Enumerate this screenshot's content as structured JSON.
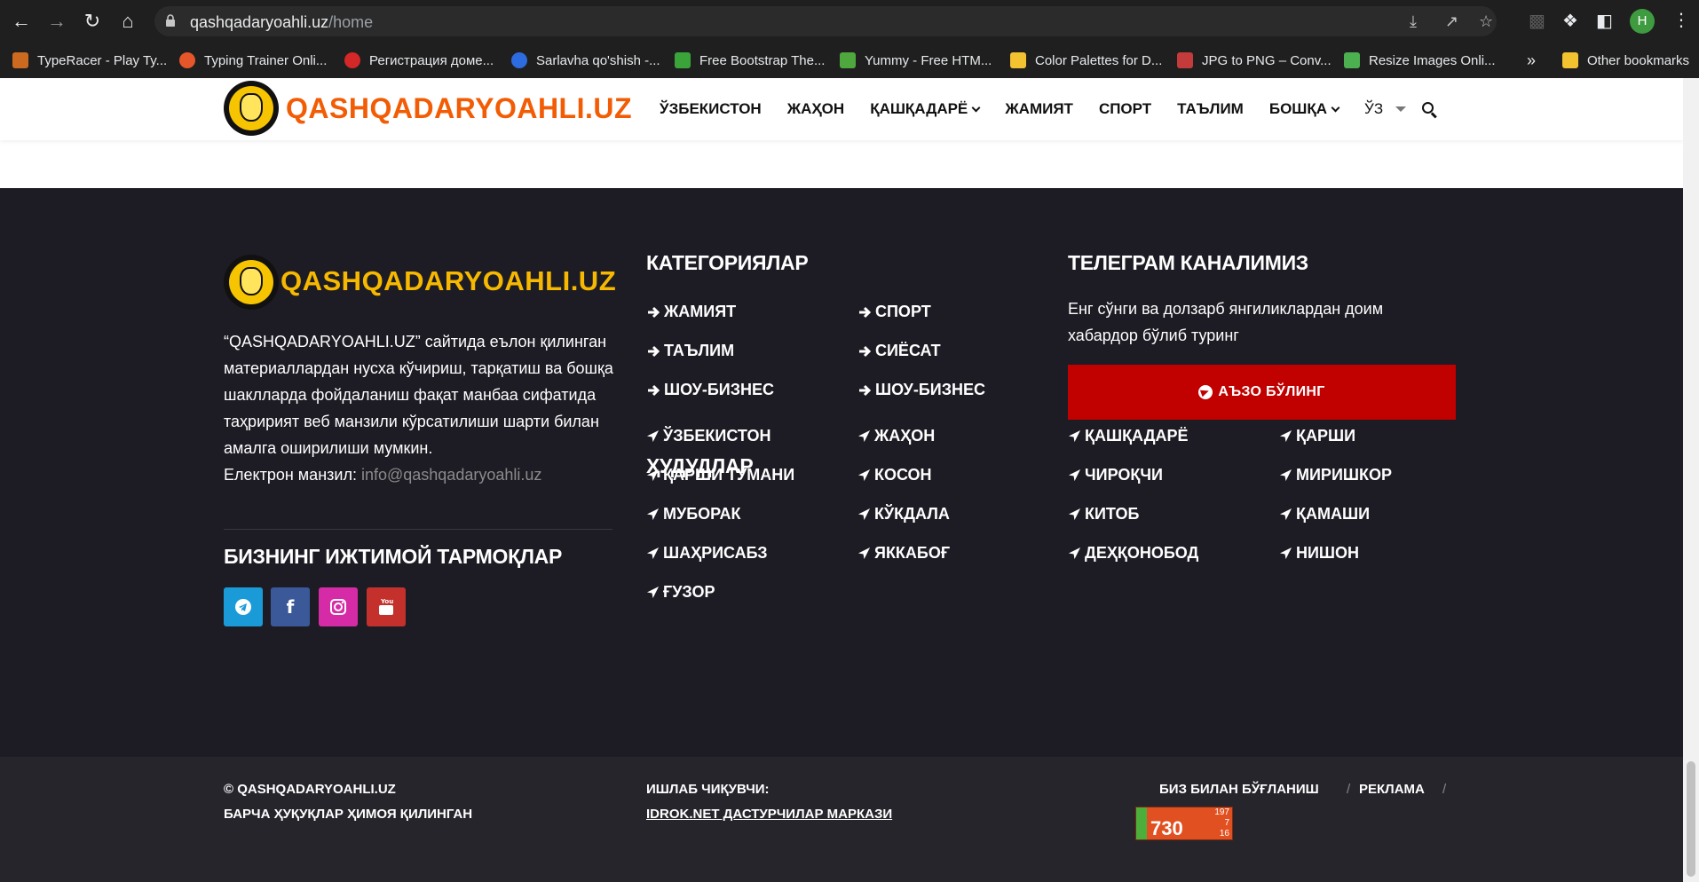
{
  "browser": {
    "url_domain": "qashqadaryoahli.uz",
    "url_path": "/home",
    "profile_initial": "H",
    "bookmarks": [
      {
        "label": "TypeRacer - Play Ty...",
        "color": "#cc6a1f"
      },
      {
        "label": "Typing Trainer Onli...",
        "color": "#e5572a"
      },
      {
        "label": "Регистрация доме...",
        "color": "#d42727"
      },
      {
        "label": "Sarlavha qo'shish -...",
        "color": "#2d6be0"
      },
      {
        "label": "Free Bootstrap The...",
        "color": "#3aa43a"
      },
      {
        "label": "Yummy - Free HTM...",
        "color": "#4fa83d"
      },
      {
        "label": "Color Palettes for D...",
        "color": "#f2c230"
      },
      {
        "label": "JPG to PNG – Conv...",
        "color": "#c43b3b"
      },
      {
        "label": "Resize Images Onli...",
        "color": "#4caf50"
      }
    ],
    "more_bookmarks": "»",
    "other_bookmarks": "Other bookmarks"
  },
  "header": {
    "logo_text": "QASHQADARYOAHLI.UZ",
    "nav": [
      {
        "label": "ЎЗБЕКИСТОН",
        "dropdown": false
      },
      {
        "label": "ЖАҲОН",
        "dropdown": false
      },
      {
        "label": "ҚАШҚАДАРЁ",
        "dropdown": true
      },
      {
        "label": "ЖАМИЯТ",
        "dropdown": false
      },
      {
        "label": "СПОРТ",
        "dropdown": false
      },
      {
        "label": "ТАЪЛИМ",
        "dropdown": false
      },
      {
        "label": "БОШҚА",
        "dropdown": true
      }
    ],
    "language": "ЎЗ"
  },
  "footer": {
    "logo_text": "QASHQADARYOAHLI.UZ",
    "about": "“QASHQADARYOAHLI.UZ” сайтида еълон қилинган материаллардан нусха кўчириш, тарқатиш ва бошқа шаклларда фойдаланиш фақат манбаа сифатида таҳририят веб манзили кўрсатилиши шарти билан амалга оширилиши мумкин.",
    "email_label": "Електрон манзил:",
    "email": "info@qashqadaryoahli.uz",
    "social_title": "БИЗНИНГ ИЖТИМОЙ ТАРМОҚЛАР",
    "social": [
      {
        "icon": "telegram-icon",
        "color": "#1a9bd7"
      },
      {
        "icon": "facebook-icon",
        "color": "#3b5998"
      },
      {
        "icon": "instagram-icon",
        "color": "#d62ba6"
      },
      {
        "icon": "youtube-icon",
        "color": "#c4302b"
      }
    ],
    "categories_title": "КАТЕГОРИЯЛАР",
    "categories": [
      "ЖАМИЯТ",
      "СПОРТ",
      "ТАЪЛИМ",
      "СИЁСАТ",
      "ШОУ-БИЗНЕС",
      "ШОУ-БИЗНЕС"
    ],
    "regions_title": "ҲУДУДЛАР",
    "regions": [
      "ЎЗБЕКИСТОН",
      "ЖАҲОН",
      "ҚАШҚАДАРЁ",
      "ҚАРШИ",
      "ҚАРШИ ТУМАНИ",
      "КОСОН",
      "ЧИРОҚЧИ",
      "МИРИШКОР",
      "МУБОРАК",
      "КЎКДАЛА",
      "КИТОБ",
      "ҚАМАШИ",
      "ШАҲРИСАБЗ",
      "ЯККАБОҒ",
      "ДЕҲҚОНОБОД",
      "НИШОН",
      "ҒУЗОР"
    ],
    "telegram_title": "ТЕЛЕГРАМ КАНАЛИМИЗ",
    "telegram_desc": "Енг сўнги ва долзарб янгиликлардан доим хабардор бўлиб туринг",
    "join_label": "АЪЗО БЎЛИНГ"
  },
  "footer_bottom": {
    "copyright": "© QASHQADARYOAHLI.UZ",
    "rights": "БАРЧА ҲУҚУҚЛАР ҲИМОЯ ҚИЛИНГАН",
    "developer_label": "ИШЛАБ ЧИҚУВЧИ:",
    "developer_link": "IDROK.NET ДАСТУРЧИЛАР МАРКАЗИ",
    "links": [
      "БИЗ БИЛАН БЎҒЛАНИШ",
      "РЕКЛАМА"
    ],
    "separator": "/",
    "counter": {
      "main": "730",
      "top": "197",
      "mid": "7",
      "bottom": "16"
    }
  },
  "colors": {
    "logo_orange": "#f25c05",
    "logo_yellow": "#f6b800",
    "footer_bg": "#1d1c24",
    "button_red": "#c10000"
  }
}
